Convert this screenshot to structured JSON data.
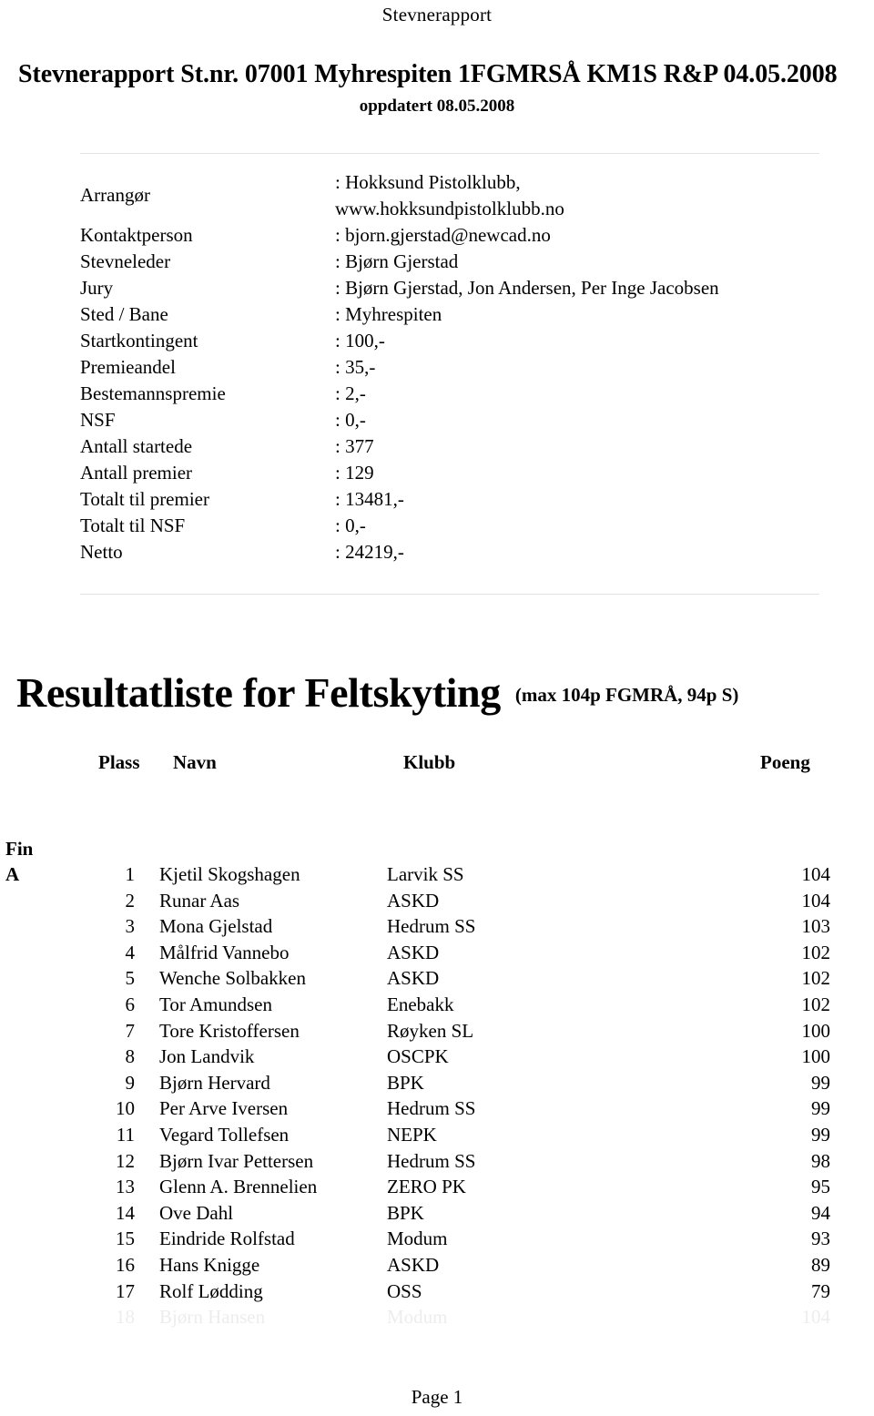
{
  "running_header": "Stevnerapport",
  "title": "Stevnerapport St.nr. 07001 Myhrespiten 1FGMRSÅ KM1S R&P  04.05.2008",
  "subtitle": "oppdatert 08.05.2008",
  "info": {
    "rows": [
      {
        "label": "Arrangør",
        "value": ": Hokksund Pistolklubb,\nwww.hokksundpistolklubb.no"
      },
      {
        "label": "Kontaktperson",
        "value": ": bjorn.gjerstad@newcad.no"
      },
      {
        "label": "Stevneleder",
        "value": ": Bjørn Gjerstad"
      },
      {
        "label": "Jury",
        "value": ": Bjørn Gjerstad, Jon Andersen, Per Inge Jacobsen"
      },
      {
        "label": "Sted / Bane",
        "value": ": Myhrespiten"
      },
      {
        "label": "Startkontingent",
        "value": ": 100,-"
      },
      {
        "label": "Premieandel",
        "value": ": 35,-"
      },
      {
        "label": "Bestemannspremie",
        "value": ": 2,-"
      },
      {
        "label": "NSF",
        "value": ": 0,-"
      },
      {
        "label": "Antall startede",
        "value": ": 377"
      },
      {
        "label": "Antall premier",
        "value": ": 129"
      },
      {
        "label": "Totalt til premier",
        "value": ": 13481,-"
      },
      {
        "label": "Totalt til NSF",
        "value": ": 0,-"
      },
      {
        "label": "Netto",
        "value": ": 24219,-"
      }
    ]
  },
  "results": {
    "heading": "Resultatliste for Feltskyting",
    "max_note": "(max 104p FGMRÅ, 94p S)",
    "columns": {
      "plass": "Plass",
      "navn": "Navn",
      "klubb": "Klubb",
      "poeng": "Poeng"
    },
    "class_name": "Fin",
    "class_group": "A",
    "rows": [
      {
        "plass": "1",
        "navn": "Kjetil Skogshagen",
        "klubb": "Larvik SS",
        "poeng": "104"
      },
      {
        "plass": "2",
        "navn": "Runar Aas",
        "klubb": "ASKD",
        "poeng": "104"
      },
      {
        "plass": "3",
        "navn": "Mona Gjelstad",
        "klubb": "Hedrum SS",
        "poeng": "103"
      },
      {
        "plass": "4",
        "navn": "Målfrid Vannebo",
        "klubb": "ASKD",
        "poeng": "102"
      },
      {
        "plass": "5",
        "navn": "Wenche Solbakken",
        "klubb": "ASKD",
        "poeng": "102"
      },
      {
        "plass": "6",
        "navn": "Tor Amundsen",
        "klubb": "Enebakk",
        "poeng": "102"
      },
      {
        "plass": "7",
        "navn": "Tore Kristoffersen",
        "klubb": "Røyken SL",
        "poeng": "100"
      },
      {
        "plass": "8",
        "navn": "Jon Landvik",
        "klubb": "OSCPK",
        "poeng": "100"
      },
      {
        "plass": "9",
        "navn": "Bjørn Hervard",
        "klubb": "BPK",
        "poeng": "99"
      },
      {
        "plass": "10",
        "navn": "Per Arve Iversen",
        "klubb": "Hedrum SS",
        "poeng": "99"
      },
      {
        "plass": "11",
        "navn": "Vegard Tollefsen",
        "klubb": "NEPK",
        "poeng": "99"
      },
      {
        "plass": "12",
        "navn": "Bjørn Ivar Pettersen",
        "klubb": "Hedrum SS",
        "poeng": "98"
      },
      {
        "plass": "13",
        "navn": "Glenn A. Brennelien",
        "klubb": "ZERO PK",
        "poeng": "95"
      },
      {
        "plass": "14",
        "navn": "Ove Dahl",
        "klubb": "BPK",
        "poeng": "94"
      },
      {
        "plass": "15",
        "navn": "Eindride Rolfstad",
        "klubb": "Modum",
        "poeng": "93"
      },
      {
        "plass": "16",
        "navn": "Hans Knigge",
        "klubb": "ASKD",
        "poeng": "89"
      },
      {
        "plass": "17",
        "navn": "Rolf Lødding",
        "klubb": "OSS",
        "poeng": "79"
      },
      {
        "plass": "18",
        "navn": "Bjørn Hansen",
        "klubb": "Modum",
        "poeng": "104"
      }
    ]
  },
  "footer": "Page 1"
}
